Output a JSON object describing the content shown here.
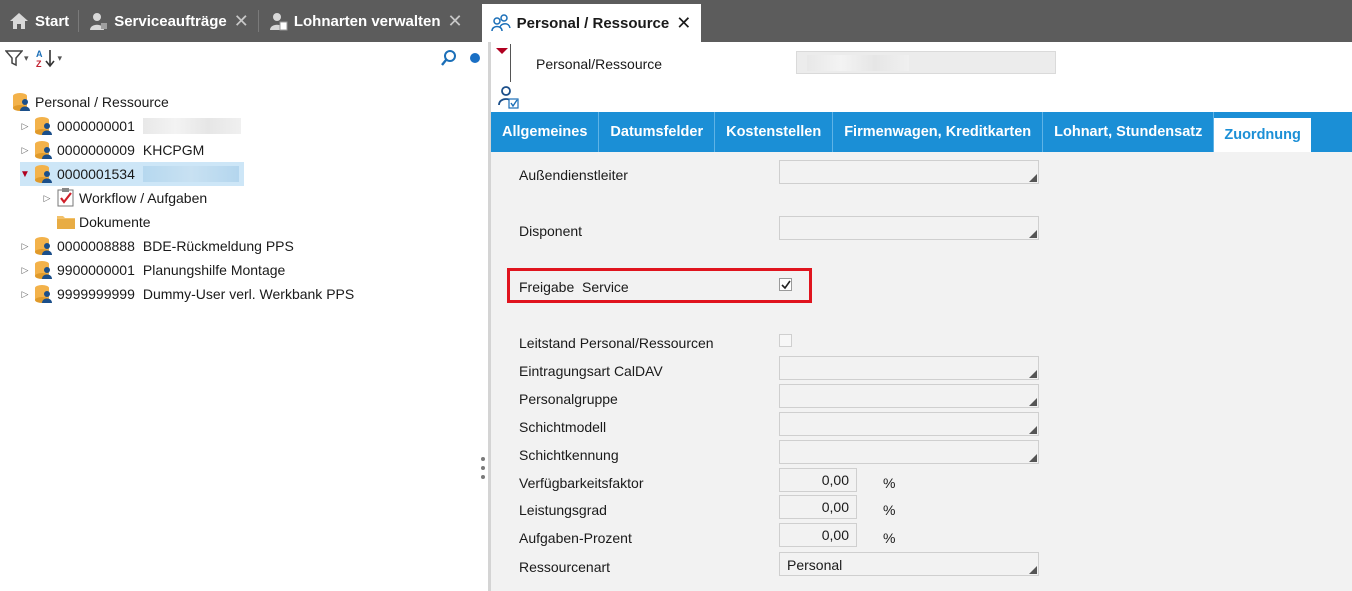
{
  "tabs": {
    "start": "Start",
    "service": "Serviceaufträge",
    "lohnarten": "Lohnarten verwalten",
    "personal": "Personal / Ressource"
  },
  "tree": {
    "root": "Personal / Ressource",
    "items": [
      {
        "id": "0000000001",
        "name": ""
      },
      {
        "id": "0000000009",
        "name": "KHCPGM"
      },
      {
        "id": "0000001534",
        "name": ""
      },
      {
        "id": "0000008888",
        "name": "BDE-Rückmeldung PPS"
      },
      {
        "id": "9900000001",
        "name": "Planungshilfe Montage"
      },
      {
        "id": "9999999999",
        "name": "Dummy-User verl. Werkbank PPS"
      }
    ],
    "children": {
      "workflow": "Workflow / Aufgaben",
      "dokumente": "Dokumente"
    }
  },
  "header": {
    "label": "Personal/Ressource",
    "value": ""
  },
  "subtabs": [
    "Allgemeines",
    "Datumsfelder",
    "Kostenstellen",
    "Firmenwagen, Kreditkarten",
    "Lohnart, Stundensatz",
    "Zuordnung"
  ],
  "form": {
    "aussendienstleiter": {
      "label": "Außendienstleiter",
      "value": ""
    },
    "disponent": {
      "label": "Disponent",
      "value": ""
    },
    "freigabe_service": {
      "label": "Freigabe  Service",
      "checked": true
    },
    "leitstand": {
      "label": "Leitstand Personal/Ressourcen",
      "checked": false
    },
    "eintragungsart": {
      "label": "Eintragungsart CalDAV",
      "value": ""
    },
    "personalgruppe": {
      "label": "Personalgruppe",
      "value": ""
    },
    "schichtmodell": {
      "label": "Schichtmodell",
      "value": ""
    },
    "schichtkennung": {
      "label": "Schichtkennung",
      "value": ""
    },
    "verfuegbarkeitsfaktor": {
      "label": "Verfügbarkeitsfaktor",
      "value": "0,00",
      "unit": "%"
    },
    "leistungsgrad": {
      "label": "Leistungsgrad",
      "value": "0,00",
      "unit": "%"
    },
    "aufgaben_prozent": {
      "label": "Aufgaben-Prozent",
      "value": "0,00",
      "unit": "%"
    },
    "ressourcenart": {
      "label": "Ressourcenart",
      "value": "Personal"
    }
  },
  "colors": {
    "tabbar": "#5c5c5c",
    "accent": "#1b8fd6",
    "highlight": "#e0141e",
    "selection": "#cde6f7"
  }
}
